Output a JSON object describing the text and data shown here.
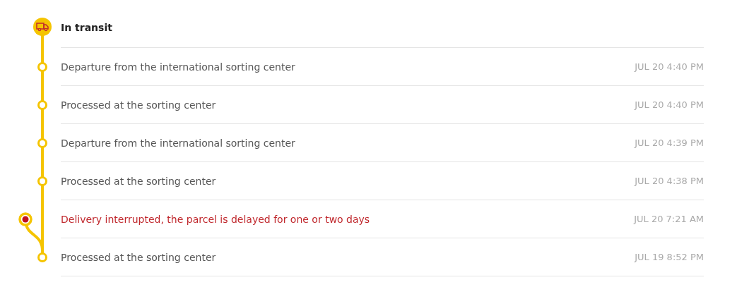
{
  "status": {
    "title": "In transit"
  },
  "events": [
    {
      "kind": "normal",
      "text": "Departure from the international sorting center",
      "time": "JUL 20 4:40 PM"
    },
    {
      "kind": "normal",
      "text": "Processed at the sorting center",
      "time": "JUL 20 4:40 PM"
    },
    {
      "kind": "normal",
      "text": "Departure from the international sorting center",
      "time": "JUL 20 4:39 PM"
    },
    {
      "kind": "normal",
      "text": "Processed at the sorting center",
      "time": "JUL 20 4:38 PM"
    },
    {
      "kind": "alert",
      "text": "Delivery interrupted, the parcel is delayed for one or two days",
      "time": "JUL 20 7:21 AM"
    },
    {
      "kind": "normal",
      "text": "Processed at the sorting center",
      "time": "JUL 19 8:52 PM"
    }
  ]
}
